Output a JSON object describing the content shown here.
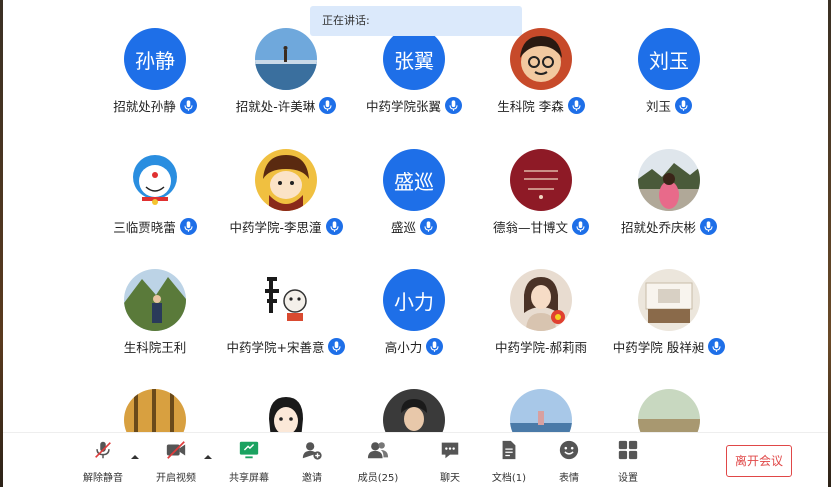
{
  "speaking_label": "正在讲话:",
  "participants": [
    {
      "name": "招就处孙静",
      "avatar_text": "孙静"
    },
    {
      "name": "招就处-许美琳"
    },
    {
      "name": "中药学院张翼",
      "avatar_text": "张翼"
    },
    {
      "name": "生科院 李森"
    },
    {
      "name": "刘玉",
      "avatar_text": "刘玉"
    },
    {
      "name": "三临贾晓蕾"
    },
    {
      "name": "中药学院-李思潼"
    },
    {
      "name": "盛巡",
      "avatar_text": "盛巡"
    },
    {
      "name": "德翁—甘博文"
    },
    {
      "name": "招就处乔庆彬"
    },
    {
      "name": "生科院王利"
    },
    {
      "name": "中药学院+宋善意"
    },
    {
      "name": "高小力",
      "avatar_text": "小力"
    },
    {
      "name": "中药学院-郝莉雨"
    },
    {
      "name": "中药学院 殷祥昶"
    },
    {
      "name": ""
    },
    {
      "name": ""
    },
    {
      "name": ""
    },
    {
      "name": ""
    },
    {
      "name": ""
    }
  ],
  "toolbar": {
    "unmute": "解除静音",
    "start_video": "开启视频",
    "share_screen": "共享屏幕",
    "invite": "邀请",
    "members": "成员(25)",
    "chat": "聊天",
    "docs": "文档(1)",
    "emoji": "表情",
    "settings": "设置",
    "leave": "离开会议"
  },
  "colors": {
    "accent": "#1e6fe8",
    "leave": "#e04848",
    "speaking_bg": "#dbe9fb",
    "share_green": "#1aa260"
  }
}
